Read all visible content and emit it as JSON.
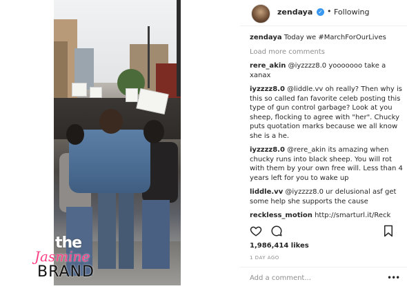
{
  "header": {
    "username": "zendaya",
    "verified_mark": "✓",
    "separator": "•",
    "follow_status": "Following"
  },
  "caption": {
    "user": "zendaya",
    "text": "Today we #MarchForOurLives"
  },
  "load_more_label": "Load more comments",
  "comments": [
    {
      "user": "rere_akin",
      "text": "@iyzzzz8.0 yooooooo take a xanax"
    },
    {
      "user": "iyzzzz8.0",
      "text": "@liddle.vv oh really? Then why is this so called fan favorite celeb posting this type of gun control garbage? Look at you sheep, flocking to agree with \"her\". Chucky puts quotation marks because we all know she is a he."
    },
    {
      "user": "iyzzzz8.0",
      "text": "@rere_akin its amazing when chucky runs into black sheep. You will rot with them by your own free will. Less than 4 years left for you to wake up"
    },
    {
      "user": "liddle.vv",
      "text": "@iyzzzz8.0 ur delusional asf get some help she supports the cause"
    },
    {
      "user": "reckless_motion",
      "text": "http://smarturl.it/Reck"
    }
  ],
  "actions": {
    "like_icon": "heart-icon",
    "comment_icon": "comment-icon",
    "save_icon": "bookmark-icon"
  },
  "likes_text": "1,986,414 likes",
  "time_ago": "1 DAY AGO",
  "add_comment_placeholder": "Add a comment...",
  "more_options": "•••",
  "watermark": {
    "line1": "the",
    "line2": "Jasmine",
    "line3": "BRAND"
  },
  "colors": {
    "text": "#262626",
    "muted": "#8e8e8e",
    "verified": "#3897f0",
    "watermark_pink": "#ff3f85"
  }
}
